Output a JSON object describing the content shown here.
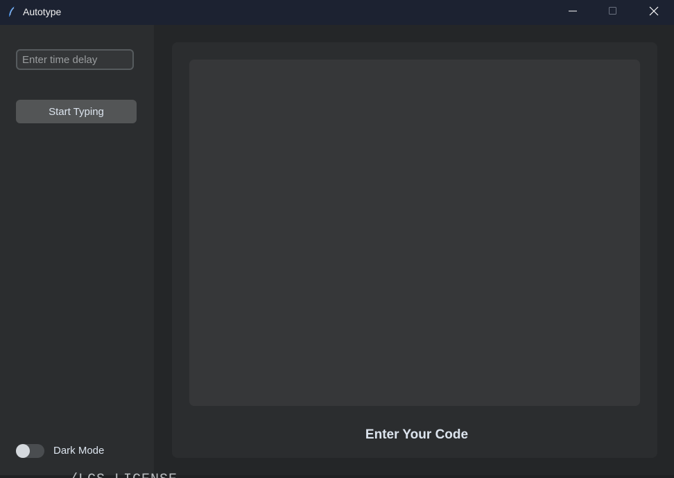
{
  "window": {
    "title": "Autotype",
    "app_icon": "feather-icon",
    "controls": {
      "minimize_icon": "minimize-icon",
      "maximize_icon": "maximize-icon",
      "close_icon": "close-icon"
    }
  },
  "sidebar": {
    "delay_input": {
      "placeholder": "Enter time delay",
      "value": ""
    },
    "start_button_label": "Start Typing",
    "dark_mode": {
      "label": "Dark Mode",
      "enabled": false
    }
  },
  "main": {
    "code_textbox_value": "",
    "code_label": "Enter Your Code"
  },
  "background": {
    "partial_text": "/LCS LICENSE"
  },
  "colors": {
    "titlebar": "#1c2231",
    "sidebar": "#2b2d2f",
    "window": "#242628",
    "panel": "#2b2d2f",
    "textbox": "#363739",
    "button": "#535556",
    "text": "#dce4ee"
  }
}
